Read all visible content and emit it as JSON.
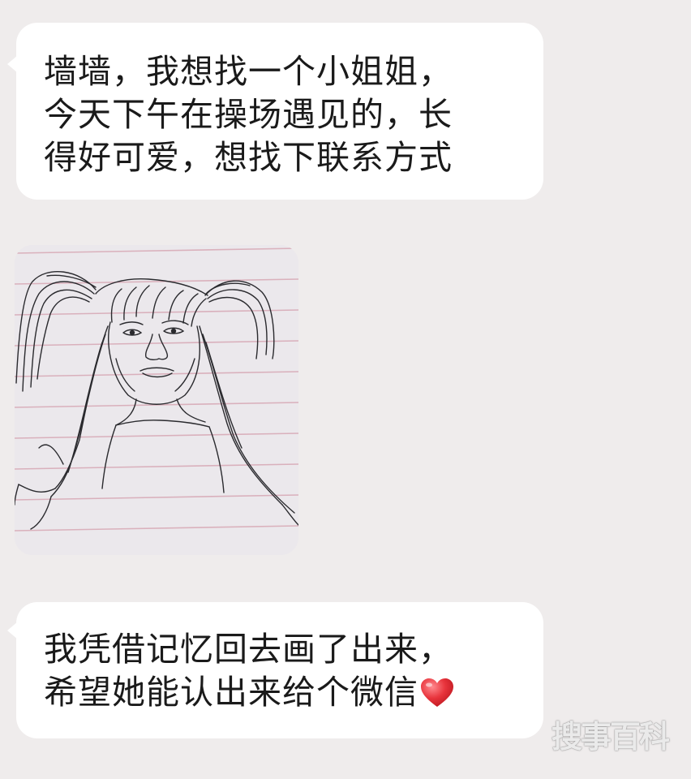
{
  "messages": [
    {
      "type": "text",
      "text": "墙墙，我想找一个小姐姐，\n今天下午在操场遇见的，长\n得好可爱，想找下联系方式"
    },
    {
      "type": "image",
      "image_description": "hand-drawn sketch of a girl with pigtails on lined paper"
    },
    {
      "type": "text",
      "text": "我凭借记忆回去画了出来，\n希望她能认出来给个微信",
      "emoji": "red-heart"
    }
  ],
  "watermark": "搜事百科",
  "colors": {
    "background": "#efecec",
    "bubble": "#ffffff",
    "text": "#1a1a1a",
    "heart": "#e8343c"
  }
}
